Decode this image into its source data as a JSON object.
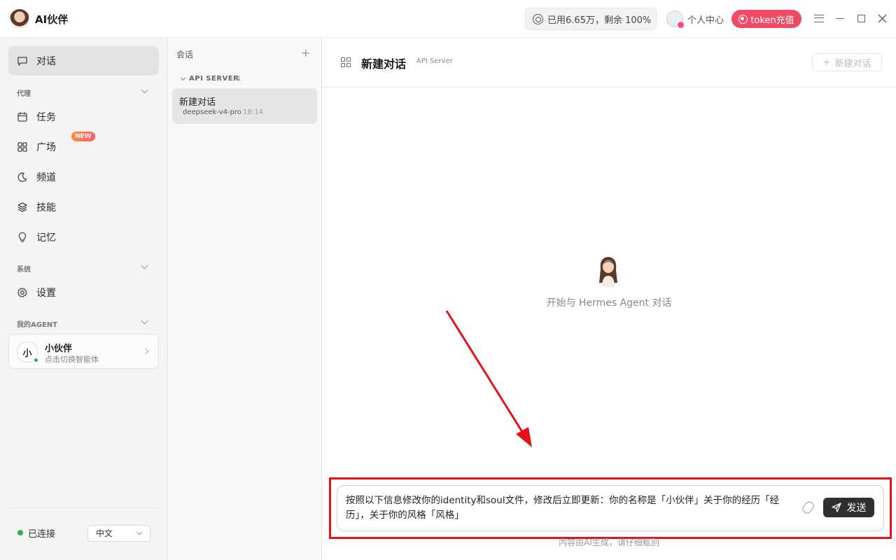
{
  "app": {
    "title": "AI伙伴"
  },
  "header": {
    "usage": "已用6.65万，剩余 100%",
    "user_center": "个人中心",
    "recharge": "token充值"
  },
  "sidebar": {
    "items": [
      {
        "label": "对话",
        "icon": "chat-icon"
      },
      {
        "label": "任务",
        "icon": "calendar-icon"
      },
      {
        "label": "广场",
        "icon": "grid-icon"
      },
      {
        "label": "频道",
        "icon": "moon-icon"
      },
      {
        "label": "技能",
        "icon": "layers-icon"
      },
      {
        "label": "记忆",
        "icon": "bulb-icon"
      },
      {
        "label": "设置",
        "icon": "gear-icon"
      }
    ],
    "sections": {
      "agent": "代理",
      "system": "系统",
      "my_agent": "我的AGENT"
    },
    "new_badge": "NEW",
    "agent_card": {
      "avatar": "小",
      "name": "小伙伴",
      "sub": "点击切换智能体"
    },
    "status": "已连接",
    "language": "中文"
  },
  "sessions": {
    "title": "会话",
    "group": {
      "name": "API SERVER",
      "count": "1"
    },
    "items": [
      {
        "name": "新建对话",
        "model": "deepseek-v4-pro",
        "time": "18:14"
      }
    ]
  },
  "main": {
    "title": "新建对话",
    "subtitle": "API Server",
    "new_chat": "新建对话",
    "welcome": "开始与 Hermes Agent 对话",
    "input_text": "按照以下信息修改你的identity和soul文件，修改后立即更新：你的名称是「小伙伴」关于你的经历「经历」，关于你的风格「风格」",
    "send": "发送",
    "footer": "内容由AI生成，请仔细甄别"
  },
  "colors": {
    "accent": "#f04a64",
    "highlight": "#e8101a",
    "online": "#2bb34a"
  }
}
